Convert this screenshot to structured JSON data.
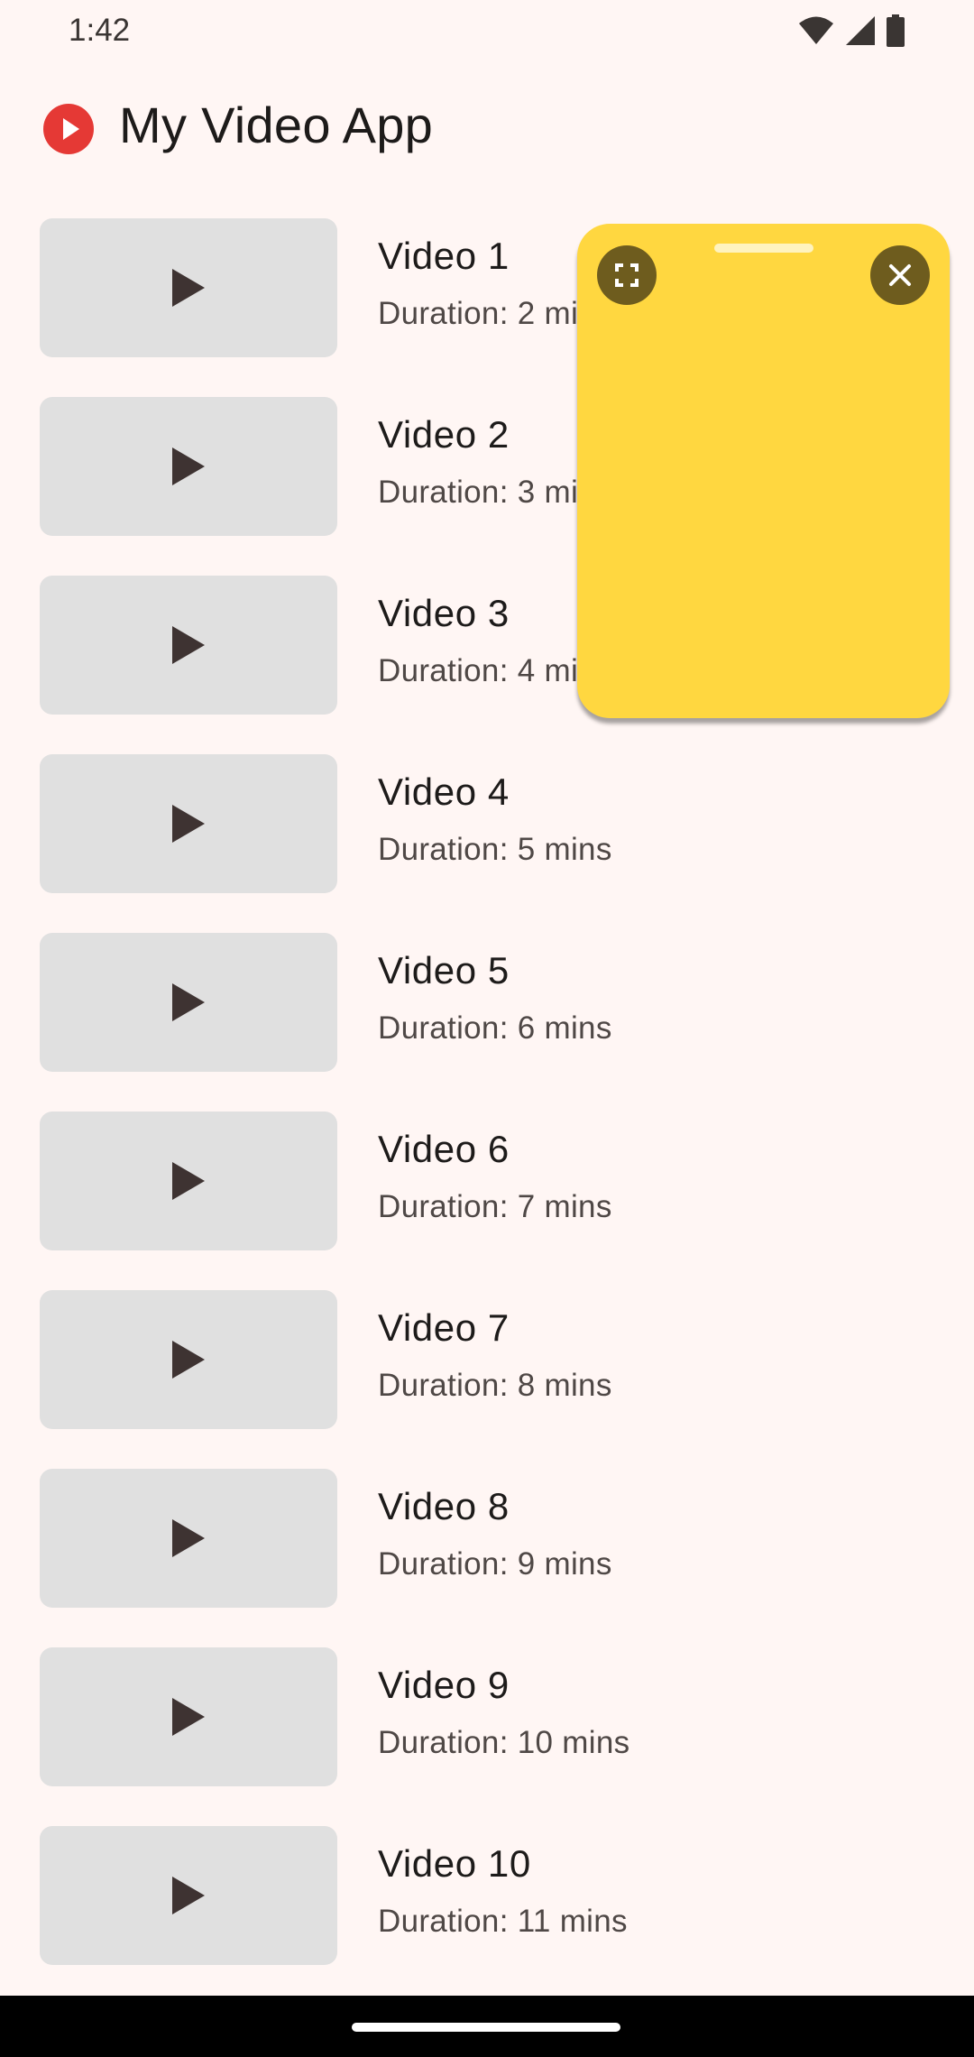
{
  "status_bar": {
    "time": "1:42",
    "icons": [
      "wifi-icon",
      "signal-icon",
      "battery-icon"
    ]
  },
  "app_bar": {
    "title": "My Video App",
    "logo_icon": "play-circle-icon",
    "logo_color": "#e53935"
  },
  "videos": [
    {
      "title": "Video 1",
      "duration": "Duration: 2 mins"
    },
    {
      "title": "Video 2",
      "duration": "Duration: 3 mins"
    },
    {
      "title": "Video 3",
      "duration": "Duration: 4 mins"
    },
    {
      "title": "Video 4",
      "duration": "Duration: 5 mins"
    },
    {
      "title": "Video 5",
      "duration": "Duration: 6 mins"
    },
    {
      "title": "Video 6",
      "duration": "Duration: 7 mins"
    },
    {
      "title": "Video 7",
      "duration": "Duration: 8 mins"
    },
    {
      "title": "Video 8",
      "duration": "Duration: 9 mins"
    },
    {
      "title": "Video 9",
      "duration": "Duration: 10 mins"
    },
    {
      "title": "Video 10",
      "duration": "Duration: 11 mins"
    }
  ],
  "pip_player": {
    "background": "#ffd740",
    "expand_icon": "fullscreen-icon",
    "close_icon": "close-icon"
  },
  "colors": {
    "background": "#fff6f4",
    "thumbnail": "#e0e0e0",
    "play_icon": "#3e3332"
  }
}
